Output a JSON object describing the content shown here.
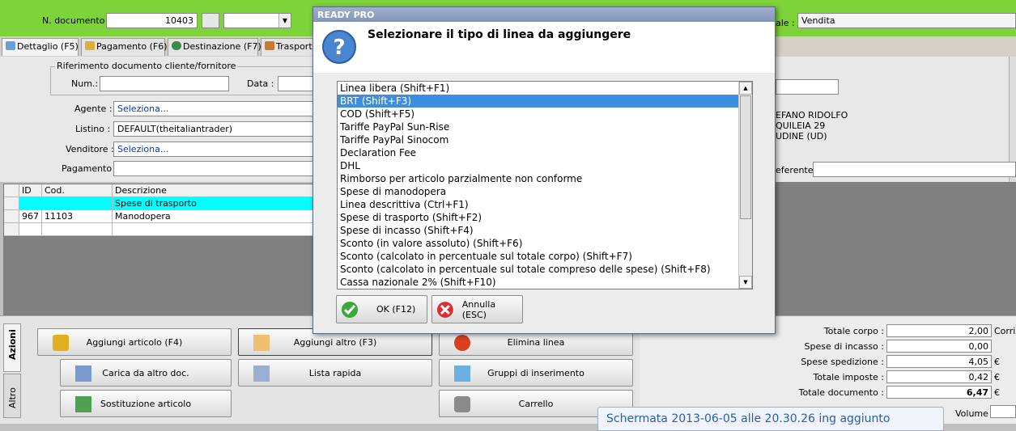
{
  "header": {
    "ndoc_label": "N. documento :",
    "ndoc_value": "10403",
    "right_label": "ale :",
    "right_value": "Vendita"
  },
  "tabs": [
    {
      "label": "Dettaglio (F5)"
    },
    {
      "label": "Pagamento (F6)"
    },
    {
      "label": "Destinazione (F7)"
    },
    {
      "label": "Trasporto"
    }
  ],
  "rif": {
    "legend": "Riferimento documento cliente/fornitore",
    "num_label": "Num.:",
    "data_label": "Data :"
  },
  "form": {
    "agente_label": "Agente :",
    "agente_value": "Seleziona...",
    "listino_label": "Listino :",
    "listino_value": "DEFAULT(theitaliantrader)",
    "venditore_label": "Venditore :",
    "venditore_value": "Seleziona...",
    "pagamento_label": "Pagamento :"
  },
  "address": {
    "line1": "EFANO RIDOLFO",
    "line2": "QUILEIA 29",
    "line3": "UDINE (UD)",
    "referente_label": "eferente"
  },
  "table": {
    "headers": [
      "ID",
      "Cod.",
      "Descrizione"
    ],
    "rows": [
      {
        "id": "",
        "cod": "",
        "desc": "Spese di trasporto"
      },
      {
        "id": "967",
        "cod": "11103",
        "desc": "Manodopera"
      }
    ]
  },
  "side_tabs": {
    "azioni": "Azioni",
    "altro": "Altro"
  },
  "actions": {
    "aggiungi_articolo": "Aggiungi articolo (F4)",
    "aggiungi_altro": "Aggiungi altro (F3)",
    "elimina_linea": "Elimina linea",
    "carica": "Carica da altro doc.",
    "lista_rapida": "Lista rapida",
    "gruppi": "Gruppi di inserimento",
    "sostituzione": "Sostituzione articolo",
    "carrello": "Carrello"
  },
  "totals": {
    "rows": [
      {
        "label": "Totale corpo :",
        "value": "2,00",
        "unit": "Corris"
      },
      {
        "label": "Spese di incasso :",
        "value": "0,00",
        "unit": ""
      },
      {
        "label": "Spese spedizione :",
        "value": "4,05",
        "unit": "€"
      },
      {
        "label": "Totale imposte :",
        "value": "0,42",
        "unit": "€"
      },
      {
        "label": "Totale documento :",
        "value": "6,47",
        "unit": "€"
      }
    ],
    "volume_label": "Volume :"
  },
  "dialog": {
    "title": "READY PRO",
    "heading": "Selezionare il tipo di linea da aggiungere",
    "items": [
      "Linea libera (Shift+F1)",
      "BRT (Shift+F3)",
      "COD (Shift+F5)",
      "Tariffe PayPal Sun-Rise",
      "Tariffe PayPal Sinocom",
      "Declaration Fee",
      "DHL",
      "Rimborso per articolo parzialmente non conforme",
      "Spese di manodopera",
      "Linea descrittiva (Ctrl+F1)",
      "Spese di trasporto (Shift+F2)",
      "Spese di incasso (Shift+F4)",
      "Sconto (in valore assoluto) (Shift+F6)",
      "Sconto (calcolato in percentuale sul totale corpo) (Shift+F7)",
      "Sconto (calcolato in percentuale sul totale compreso delle spese) (Shift+F8)",
      "Cassa nazionale 2% (Shift+F10)"
    ],
    "selected_index": 1,
    "ok_label": "OK (F12)",
    "cancel_label": "Annulla (ESC)"
  },
  "taskbar_notice": "Schermata 2013-06-05 alle 20.30.26 ing aggiunto",
  "colors": {
    "accent_green": "#7ed23a",
    "selection_blue": "#3d8ee0",
    "highlight_cyan": "#00ffff"
  }
}
